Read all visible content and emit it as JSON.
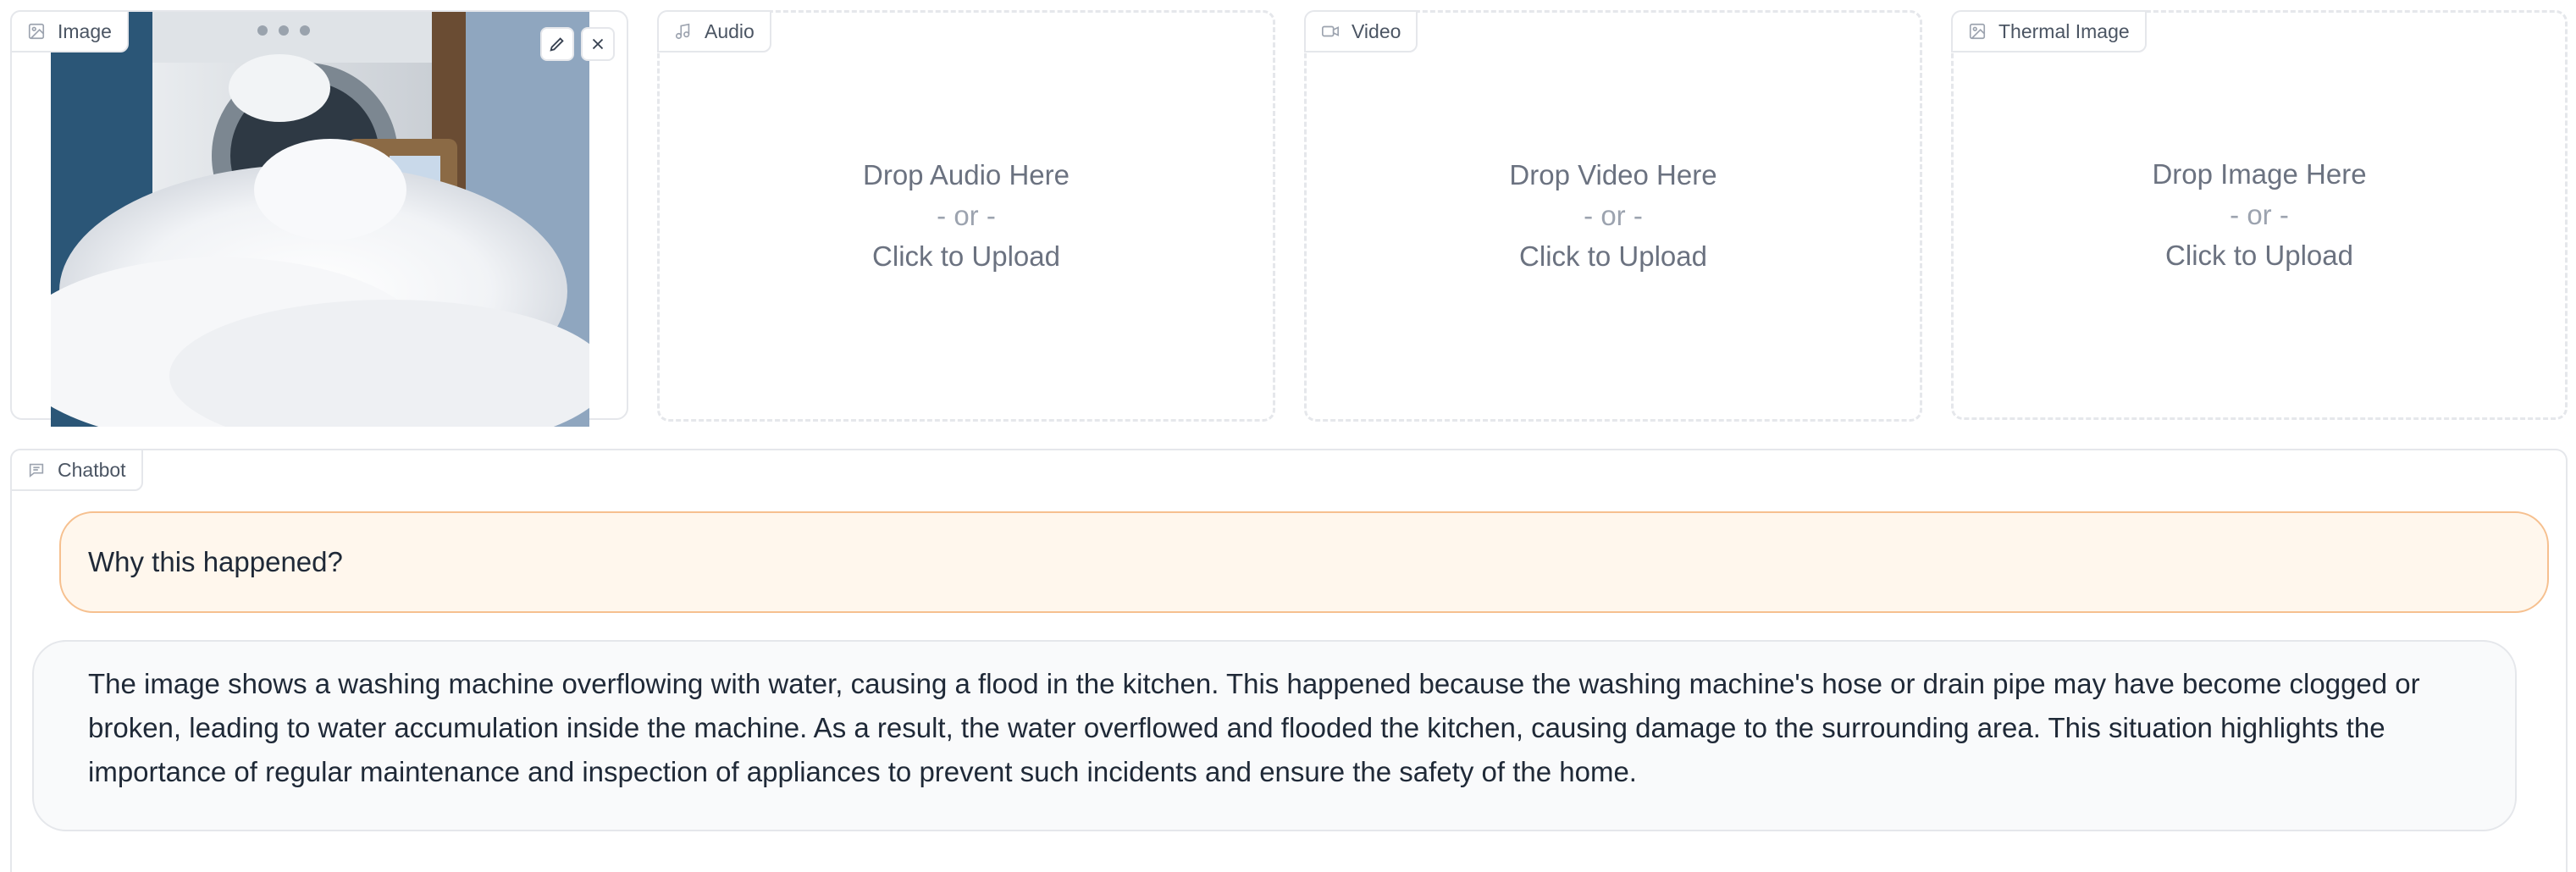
{
  "image_panel": {
    "label": "Image",
    "icon": "image-icon",
    "edit_icon": "pencil-icon",
    "clear_icon": "close-icon",
    "image_alt": "washing machine overflowing with foam"
  },
  "upload_panels": [
    {
      "label": "Audio",
      "icon": "music-note-icon",
      "drop_text": "Drop Audio Here",
      "or_text": "- or -",
      "click_text": "Click to Upload"
    },
    {
      "label": "Video",
      "icon": "video-camera-icon",
      "drop_text": "Drop Video Here",
      "or_text": "- or -",
      "click_text": "Click to Upload"
    },
    {
      "label": "Thermal Image",
      "icon": "image-icon",
      "drop_text": "Drop Image Here",
      "or_text": "- or -",
      "click_text": "Click to Upload"
    }
  ],
  "chatbot": {
    "label": "Chatbot",
    "icon": "chat-bubble-icon",
    "messages": [
      {
        "role": "user",
        "text": "Why this happened?"
      },
      {
        "role": "bot",
        "text": "The image shows a washing machine overflowing with water, causing a flood in the kitchen. This happened because the washing machine's hose or drain pipe may have become clogged or broken, leading to water accumulation inside the machine. As a result, the water overflowed and flooded the kitchen, causing damage to the surrounding area. This situation highlights the importance of regular maintenance and inspection of appliances to prevent such incidents and ensure the safety of the home."
      }
    ]
  },
  "colors": {
    "user_bubble_bg": "#fff7ed",
    "user_bubble_border": "#f6c08f",
    "bot_bubble_bg": "#f9fafb",
    "panel_border": "#e5e7eb"
  }
}
